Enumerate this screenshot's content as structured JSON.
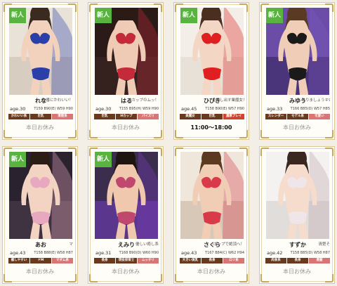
{
  "new_label": "新人",
  "colors": {
    "badge_green": "#58b33f",
    "tag_brown": "#6a3a1e",
    "tag_pink": "#d97575",
    "tag_red": "#d0442e"
  },
  "cards": [
    {
      "name": "れな",
      "catch": "本番にかわいい！",
      "age": "age.30",
      "size": "T159 B90(E) W59 H90",
      "tags": [
        "かわいい系",
        "巨乳",
        "清楚系"
      ],
      "tag_colors": [
        "#6a3a1e",
        "#6a3a1e",
        "#d97575"
      ],
      "status": "本日お休み",
      "active": false,
      "is_new": true
    },
    {
      "name": "はる",
      "catch": "Hカップのムッ！",
      "age": "age.30",
      "size": "T155 B95(H) W59 H90",
      "tags": [
        "巨乳",
        "Hカップ",
        "パイズリ"
      ],
      "tag_colors": [
        "#6a3a1e",
        "#6a3a1e",
        "#d97575"
      ],
      "status": "本日お休み",
      "active": false,
      "is_new": true
    },
    {
      "name": "ひびき",
      "catch": "を探し出す業魔女！",
      "age": "age.45",
      "size": "T158 B90(E) W57 H90",
      "tags": [
        "美魔女",
        "巨乳",
        "濃厚プレイ"
      ],
      "tag_colors": [
        "#6a3a1e",
        "#6a3a1e",
        "#d0442e"
      ],
      "status": "11:00～18:00",
      "active": true,
      "is_new": true
    },
    {
      "name": "みゆう",
      "catch": "くなりましょう＃902",
      "age": "age.33",
      "size": "T166 B85(D) W57 H85",
      "tags": [
        "スレンダー",
        "モデル系",
        "可愛い"
      ],
      "tag_colors": [
        "#6a3a1e",
        "#6a3a1e",
        "#d97575"
      ],
      "status": "本日お休み",
      "active": false,
      "is_new": true
    },
    {
      "name": "あお",
      "catch": "マ",
      "age": "age.43",
      "size": "T158 B88(E) W58 H87",
      "tags": [
        "癒しやすい",
        "ドM",
        "マダム系"
      ],
      "tag_colors": [
        "#6a3a1e",
        "#6a3a1e",
        "#d97575"
      ],
      "status": "本日お休み",
      "active": false,
      "is_new": true
    },
    {
      "name": "えみり",
      "catch": "優しい癒し系",
      "age": "age.31",
      "size": "T168 B90(D) W60 H90",
      "tags": [
        "長身",
        "現役保育士",
        "ムッチリ"
      ],
      "tag_colors": [
        "#6a3a1e",
        "#6a3a1e",
        "#d97575"
      ],
      "status": "本日お休み",
      "active": false,
      "is_new": true
    },
    {
      "name": "さくら",
      "catch": "Iカップで絶頂へ！",
      "age": "age.43",
      "size": "T167 B84(C) W62 H94",
      "tags": [
        "大きい美乳",
        "長身",
        "ロリ系"
      ],
      "tag_colors": [
        "#6a3a1e",
        "#6a3a1e",
        "#d97575"
      ],
      "status": "本日お休み",
      "active": false,
      "is_new": false
    },
    {
      "name": "すずか",
      "catch": "清楚そ",
      "age": "age.42",
      "size": "T158 B85(D) W58 H87",
      "tags": [
        "肉食系",
        "長身",
        "黒髪"
      ],
      "tag_colors": [
        "#6a3a1e",
        "#6a3a1e",
        "#d97575"
      ],
      "status": "本日お休み",
      "active": false,
      "is_new": false
    }
  ]
}
